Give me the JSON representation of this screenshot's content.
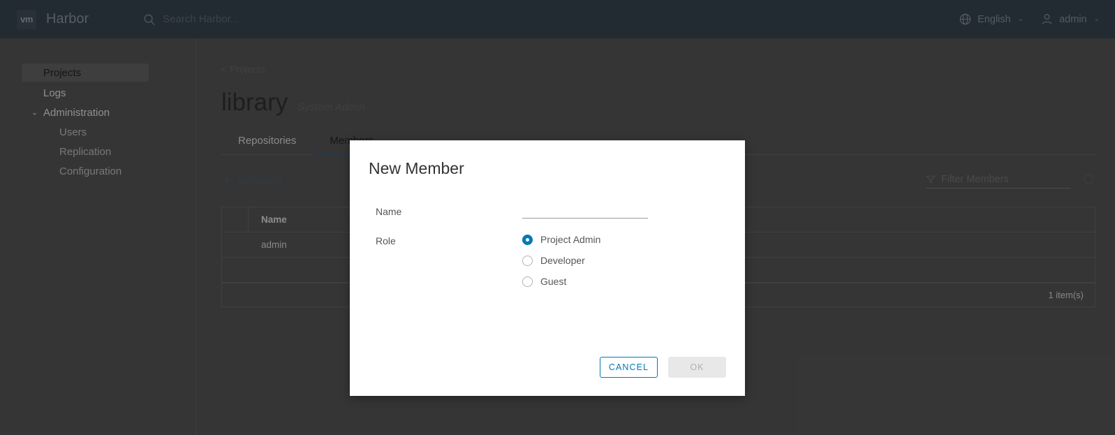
{
  "header": {
    "logo_text": "vm",
    "brand": "Harbor",
    "search_placeholder": "Search Harbor...",
    "language": "English",
    "user": "admin",
    "search_icon": "search-icon",
    "globe_icon": "globe-icon",
    "user_icon": "user-icon",
    "caret": "⌄"
  },
  "sidebar": {
    "items": [
      {
        "label": "Projects",
        "level": 0,
        "selected": true
      },
      {
        "label": "Logs",
        "level": 0,
        "selected": false
      },
      {
        "label": "Administration",
        "level": 0,
        "selected": false,
        "group": true,
        "caret": "⌄"
      },
      {
        "label": "Users",
        "level": 1,
        "selected": false
      },
      {
        "label": "Replication",
        "level": 1,
        "selected": false
      },
      {
        "label": "Configuration",
        "level": 1,
        "selected": false
      }
    ]
  },
  "main": {
    "breadcrumb": "< Projects",
    "project_name": "library",
    "project_role": "System Admin",
    "tabs": [
      {
        "label": "Repositories",
        "active": false
      },
      {
        "label": "Members",
        "active": true
      }
    ],
    "toolbar": {
      "add_member_label": "MEMBER",
      "add_member_plus": "+",
      "filter_placeholder": "Filter Members",
      "filter_icon": "funnel-filter-icon",
      "refresh_icon": "refresh-icon"
    },
    "table": {
      "columns": [
        "Name"
      ],
      "rows": [
        [
          "admin"
        ]
      ],
      "footer_count": "1 item(s)"
    }
  },
  "modal": {
    "title": "New Member",
    "name_label": "Name",
    "name_value": "",
    "name_placeholder": "",
    "role_label": "Role",
    "roles": [
      {
        "label": "Project Admin",
        "checked": true
      },
      {
        "label": "Developer",
        "checked": false
      },
      {
        "label": "Guest",
        "checked": false
      }
    ],
    "cancel_label": "CANCEL",
    "ok_label": "OK"
  },
  "colors": {
    "accent_blue": "#0079b8",
    "header_bg": "#2c3a47",
    "tab_active_underline": "#3e5061",
    "link_blue": "#45555f"
  }
}
